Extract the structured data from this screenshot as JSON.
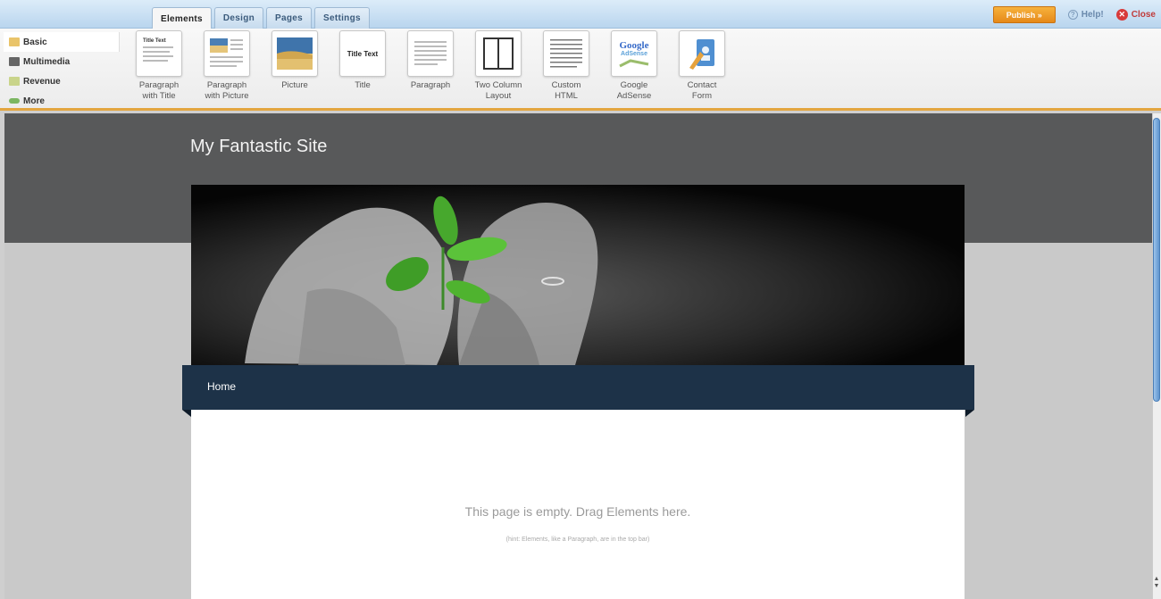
{
  "tabs": [
    {
      "label": "Elements",
      "active": true
    },
    {
      "label": "Design",
      "active": false
    },
    {
      "label": "Pages",
      "active": false
    },
    {
      "label": "Settings",
      "active": false
    }
  ],
  "top_actions": {
    "publish_label": "Publish »",
    "help_label": "Help!",
    "close_label": "Close"
  },
  "categories": [
    {
      "label": "Basic",
      "icon": "folder-icon",
      "color": "#e9c46a"
    },
    {
      "label": "Multimedia",
      "icon": "film-icon",
      "color": "#666666"
    },
    {
      "label": "Revenue",
      "icon": "money-icon",
      "color": "#c9d48a"
    },
    {
      "label": "More",
      "icon": "arrow-icon",
      "color": "#7bb661"
    }
  ],
  "elements": [
    {
      "line1": "Paragraph",
      "line2": "with Title",
      "icon": "paragraph-with-title-icon",
      "thumb_text": "Title Text"
    },
    {
      "line1": "Paragraph",
      "line2": "with Picture",
      "icon": "paragraph-with-picture-icon"
    },
    {
      "line1": "Picture",
      "line2": "",
      "icon": "picture-icon"
    },
    {
      "line1": "Title",
      "line2": "",
      "icon": "title-icon",
      "thumb_text": "Title Text"
    },
    {
      "line1": "Paragraph",
      "line2": "",
      "icon": "paragraph-icon"
    },
    {
      "line1": "Two Column",
      "line2": "Layout",
      "icon": "two-column-icon"
    },
    {
      "line1": "Custom",
      "line2": "HTML",
      "icon": "custom-html-icon"
    },
    {
      "line1": "Google",
      "line2": "AdSense",
      "icon": "google-adsense-icon",
      "thumb_text": "Google",
      "thumb_sub": "AdSense"
    },
    {
      "line1": "Contact",
      "line2": "Form",
      "icon": "contact-form-icon"
    }
  ],
  "site": {
    "title": "My Fantastic Site",
    "nav_home": "Home",
    "empty_message": "This page is empty. Drag Elements here.",
    "hint_message": "(hint: Elements, like a Paragraph, are in the top bar)"
  },
  "colors": {
    "accent_orange": "#e6891a",
    "nav_dark_blue": "#1d3248",
    "header_gray": "#58595a"
  }
}
